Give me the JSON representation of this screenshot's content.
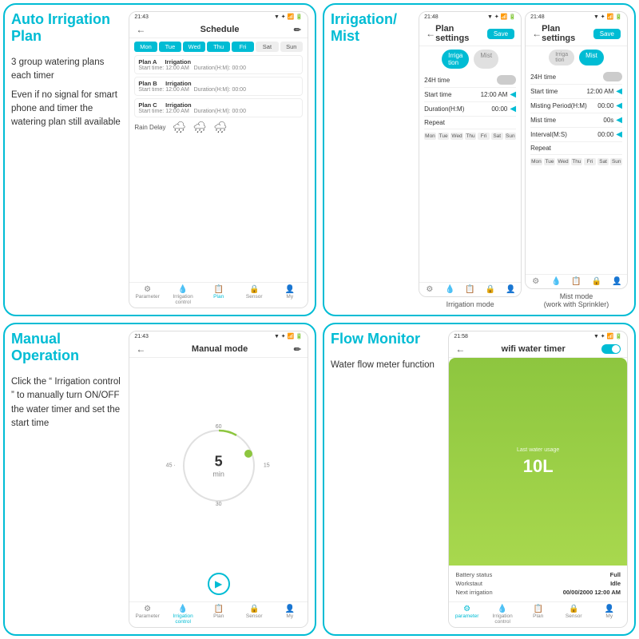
{
  "quadrants": {
    "auto_irrigation": {
      "title": "Auto Irrigation Plan",
      "text1": "3 group watering plans each timer",
      "text2": "Even if no signal for smart phone and timer the watering plan still available",
      "phone": {
        "status": "21:43",
        "header": "Schedule",
        "weekdays": [
          "Mon",
          "Tue",
          "Wed",
          "Thu",
          "Fri",
          "Sat",
          "Sun"
        ],
        "plans": [
          {
            "name": "Plan A",
            "type": "Irrigation",
            "start": "Start time: 12:00 AM",
            "duration": "Duration(H:M): 00:00"
          },
          {
            "name": "Plan B",
            "type": "Irrigation",
            "start": "Start time: 12:00 AM",
            "duration": "Duration(H:M): 00:00"
          },
          {
            "name": "Plan C",
            "type": "Irrigation",
            "start": "Start time: 12:00 AM",
            "duration": "Duration(H:M): 00:00"
          }
        ],
        "rain_delay": "Rain Delay",
        "nav": [
          "Parameter",
          "Irrigation control",
          "Plan",
          "Sensor",
          "My"
        ]
      }
    },
    "irrigation_mist": {
      "title": "Irrigation/ Mist",
      "phone1": {
        "status": "21:48",
        "header": "Plan settings",
        "save": "Save",
        "mode_active": "Irriga tion",
        "mode_inactive": "Mist",
        "rows": [
          {
            "label": "24H time",
            "value": "Off",
            "type": "toggle"
          },
          {
            "label": "Start time",
            "value": "12:00 AM",
            "type": "arrow"
          },
          {
            "label": "Duration(H:M)",
            "value": "00:00",
            "type": "arrow"
          },
          {
            "label": "Repeat",
            "value": "",
            "type": "none"
          }
        ],
        "weekdays": [
          "Mon",
          "Tue",
          "Wed",
          "Thu",
          "Fri",
          "Sat",
          "Sun"
        ],
        "label": "Irrigation mode"
      },
      "phone2": {
        "status": "21:48",
        "header": "Plan settings",
        "save": "Save",
        "mode_active": "Irriga tion",
        "mode_inactive": "Mist",
        "rows": [
          {
            "label": "24H time",
            "value": "Off",
            "type": "toggle"
          },
          {
            "label": "Start time",
            "value": "12:00 AM",
            "type": "arrow"
          },
          {
            "label": "Misting Period(H:M)",
            "value": "00:00",
            "type": "arrow"
          },
          {
            "label": "Mist time",
            "value": "00s",
            "type": "arrow"
          },
          {
            "label": "Interval(M:S)",
            "value": "00:00",
            "type": "arrow"
          },
          {
            "label": "Repeat",
            "value": "",
            "type": "none"
          }
        ],
        "weekdays": [
          "Mon",
          "Tue",
          "Wed",
          "Thu",
          "Fri",
          "Sat",
          "Sun"
        ],
        "label": "Mist mode\n(work with Sprinkler)"
      }
    },
    "manual_operation": {
      "title": "Manual Operation",
      "text1": "Click the “ Irrigation control ” to manually turn ON/OFF the water timer and set the start time",
      "phone": {
        "status": "21:43",
        "header": "Manual mode",
        "center_value": "5",
        "center_unit": "min",
        "ticks": {
          "top": "60",
          "right": "15",
          "bottom": "30",
          "left": "45"
        },
        "nav": [
          "Parameter",
          "Irrigation control",
          "Plan",
          "Sensor",
          "My"
        ],
        "active_nav": 1
      }
    },
    "flow_monitor": {
      "title": "Flow Monitor",
      "text1": "Water flow meter function",
      "phone": {
        "status": "21:58",
        "header": "wifi water timer",
        "last_water_label": "Last water usage",
        "water_volume": "10L",
        "info_rows": [
          {
            "label": "Battery status",
            "value": "Full"
          },
          {
            "label": "Workstaut",
            "value": "Idle"
          },
          {
            "label": "Next irrigation",
            "value": "00/00/2000 12:00 AM"
          }
        ],
        "nav": [
          "",
          "Irrigation control",
          "Plan",
          "Sensor",
          "My"
        ]
      }
    }
  }
}
